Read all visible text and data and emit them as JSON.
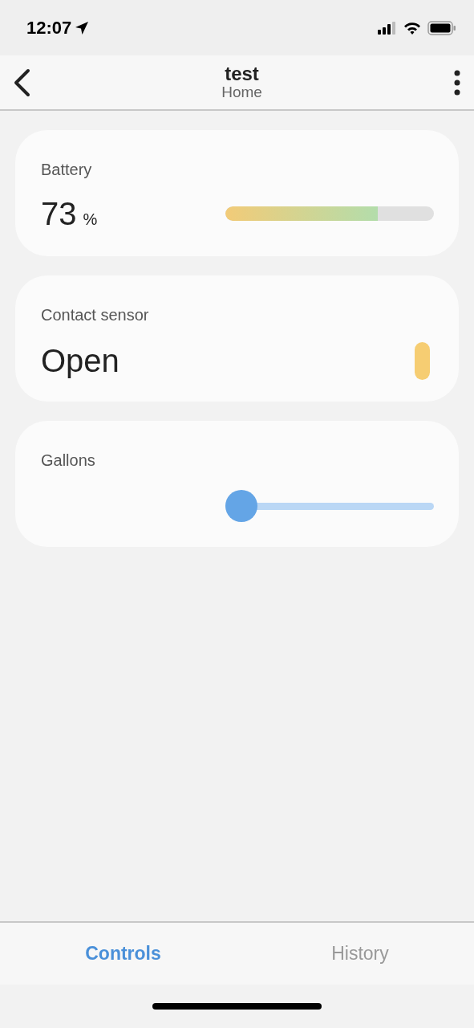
{
  "status_bar": {
    "time": "12:07"
  },
  "header": {
    "title": "test",
    "subtitle": "Home"
  },
  "cards": [
    {
      "kind": "meter",
      "title": "Battery",
      "value": "73",
      "unit": "%",
      "level": 0.73
    },
    {
      "kind": "contact",
      "title": "Contact sensor",
      "value": "Open",
      "open": true
    },
    {
      "kind": "slider",
      "title": "Gallons",
      "level": 0
    }
  ],
  "tabs": [
    {
      "label": "Controls",
      "selected": true
    },
    {
      "label": "History",
      "selected": false
    }
  ]
}
